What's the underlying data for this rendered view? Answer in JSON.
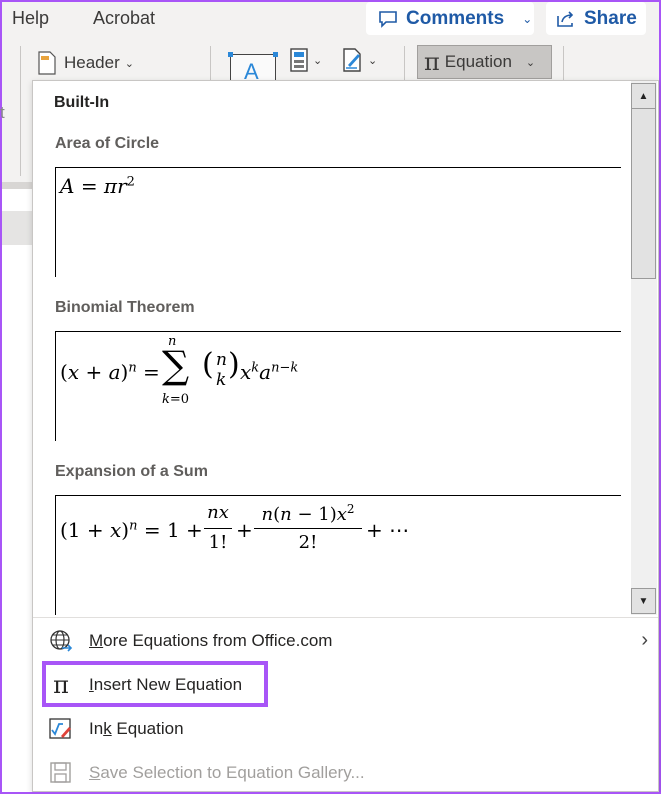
{
  "ribbon": {
    "tabs": [
      "Help",
      "Acrobat"
    ],
    "comments_label": "Comments",
    "share_label": "Share",
    "header_label": "Header",
    "equation_label": "Equation",
    "textbox_glyph": "A",
    "pi_glyph": "π",
    "left_cut_text": "t"
  },
  "dropdown": {
    "section_heading": "Built-In",
    "equations": [
      {
        "title": "Area of Circle",
        "formula": "A = πr^2"
      },
      {
        "title": "Binomial Theorem",
        "formula": "(x + a)^n = Σ_{k=0}^{n} (n choose k) x^k a^(n−k)"
      },
      {
        "title": "Expansion of a Sum",
        "formula": "(1 + x)^n = 1 + nx/1! + n(n − 1)x^2/2! + ⋯"
      }
    ],
    "menu": [
      {
        "icon": "globe-icon",
        "label": "More Equations from Office.com",
        "underline": "M",
        "rest": "ore Equations from Office.com",
        "has_submenu": true,
        "enabled": true
      },
      {
        "icon": "pi-icon",
        "label": "Insert New Equation",
        "underline": "I",
        "rest": "nsert New Equation",
        "enabled": true,
        "highlighted": true
      },
      {
        "icon": "ink-equation-icon",
        "label": "Ink Equation",
        "pre": "In",
        "underline": "k",
        "rest": " Equation",
        "enabled": true
      },
      {
        "icon": "save-icon",
        "label": "Save Selection to Equation Gallery...",
        "underline": "S",
        "rest": "ave Selection to Equation Gallery...",
        "enabled": false
      }
    ]
  },
  "colors": {
    "highlight": "#a855f7",
    "accent": "#1f5aa6"
  }
}
